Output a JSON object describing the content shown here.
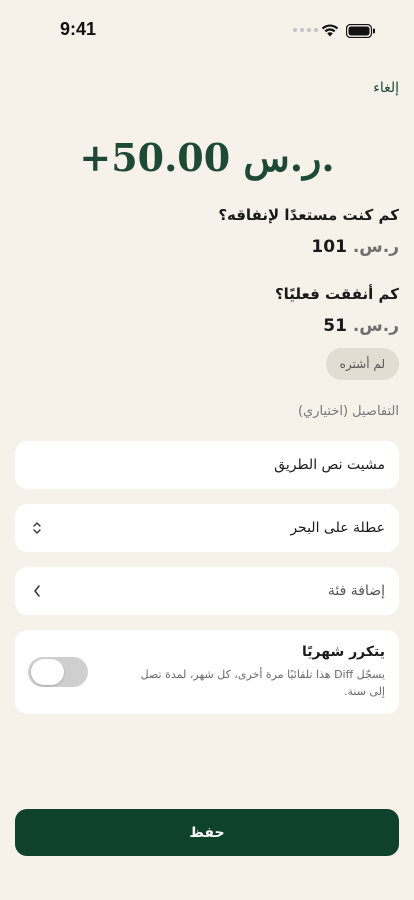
{
  "status_bar": {
    "time": "9:41"
  },
  "header": {
    "cancel_label": "إلغاء"
  },
  "amount": {
    "display": "+50.00 ر.س."
  },
  "budgeted": {
    "question": "كم كنت مستعدًا لإنفاقه؟",
    "currency": "ر.س.",
    "value": "101"
  },
  "actual": {
    "question": "كم أنفقت فعليًا؟",
    "currency": "ر.س.",
    "value": "51"
  },
  "didnt_buy_chip": "لم أشتره",
  "details": {
    "label": "التفاصيل (اختياري)",
    "note_value": "مشيت نص الطريق",
    "trip_value": "عطلة على البحر",
    "category_placeholder": "إضافة فئة"
  },
  "recurring": {
    "title": "يتكرر شهريًا",
    "subtitle": "يسجّل Diff هذا تلقائيًا مرة أخرى، كل شهر، لمدة تصل إلى سنة.",
    "enabled": false
  },
  "save_label": "حفظ",
  "colors": {
    "background": "#f6f1e9",
    "brand_green": "#0f422b",
    "amount_green": "#1e4a35",
    "card": "#ffffff",
    "chip": "#e3dcd3",
    "toggle_off": "#cfcfcf"
  },
  "icons": {
    "signal": "signal-dots-icon",
    "wifi": "wifi-icon",
    "battery": "battery-icon",
    "select": "chevron-up-down-icon",
    "category": "chevron-left-icon"
  }
}
